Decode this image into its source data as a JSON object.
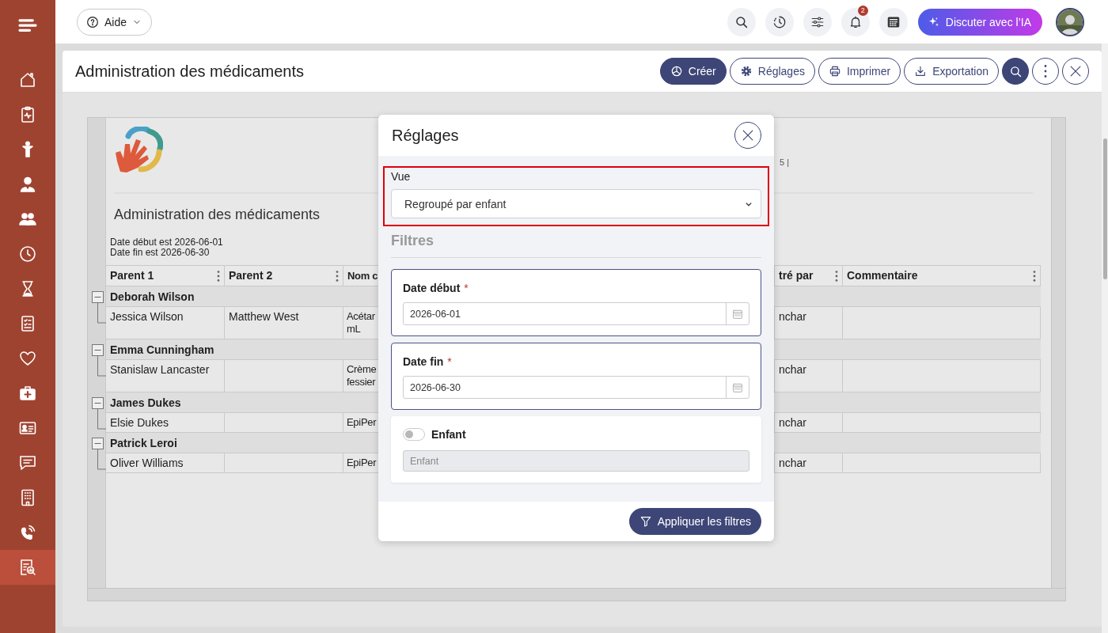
{
  "sidebar": {
    "items": [
      {
        "kind": "home",
        "selected": false
      },
      {
        "kind": "clipboard",
        "selected": false
      },
      {
        "kind": "child",
        "selected": false
      },
      {
        "kind": "user",
        "selected": false
      },
      {
        "kind": "users",
        "selected": false
      },
      {
        "kind": "clock",
        "selected": false
      },
      {
        "kind": "hourglass",
        "selected": false
      },
      {
        "kind": "checklist",
        "selected": false
      },
      {
        "kind": "heart",
        "selected": false
      },
      {
        "kind": "firstaid",
        "selected": false
      },
      {
        "kind": "idcard",
        "selected": false
      },
      {
        "kind": "chat",
        "selected": false
      },
      {
        "kind": "building",
        "selected": false
      },
      {
        "kind": "phone",
        "selected": false
      },
      {
        "kind": "report",
        "selected": true
      }
    ]
  },
  "topbar": {
    "help": "Aide",
    "icons": [
      {
        "kind": "search"
      },
      {
        "kind": "history"
      },
      {
        "kind": "sliders"
      },
      {
        "kind": "bell",
        "badge": "2"
      },
      {
        "kind": "calculator"
      }
    ],
    "ai_button": "Discuter avec l’IA"
  },
  "page": {
    "title": "Administration des médicaments",
    "actions": [
      {
        "kind": "create",
        "label": "Créer",
        "primary": true
      },
      {
        "kind": "settings",
        "label": "Réglages",
        "primary": false
      },
      {
        "kind": "print",
        "label": "Imprimer",
        "primary": false
      },
      {
        "kind": "export",
        "label": "Exportation",
        "primary": false
      },
      {
        "kind": "search",
        "primary": true
      },
      {
        "kind": "more",
        "primary": false
      },
      {
        "kind": "close",
        "primary": false
      }
    ]
  },
  "report": {
    "header_fragment": "5 |",
    "title": "Administration des médicaments",
    "criteria": [
      "Date début est 2026-06-01",
      "Date fin est 2026-06-30"
    ],
    "columns": [
      {
        "label": "Parent 1",
        "menu": true
      },
      {
        "label": "Parent 2",
        "menu": true
      },
      {
        "label": "Nom c",
        "menu": false
      },
      {
        "label": "tré par",
        "menu": true
      },
      {
        "label": "Commentaire",
        "menu": true
      }
    ],
    "groups": [
      {
        "name": "Deborah Wilson",
        "expanded": true,
        "rows": [
          {
            "parent_1": "Jessica Wilson",
            "parent_2": "Matthew West",
            "column_3": "Acétar mL",
            "column_4": "nchar"
          }
        ]
      },
      {
        "name": "Emma Cunningham",
        "expanded": true,
        "rows": [
          {
            "parent_1": "Stanislaw Lancaster",
            "column_3": "Crème fessier",
            "column_4": "nchar"
          }
        ]
      },
      {
        "name": "James Dukes",
        "expanded": true,
        "rows": [
          {
            "parent_1": "Elsie Dukes",
            "column_3": "EpiPer",
            "column_4": "nchar"
          }
        ]
      },
      {
        "name": "Patrick Leroi",
        "expanded": true,
        "rows": [
          {
            "parent_1": "Oliver Williams",
            "column_3": "EpiPer",
            "column_4": "nchar"
          }
        ]
      }
    ]
  },
  "modal": {
    "title": "Réglages",
    "view": {
      "label": "Vue",
      "value": "Regroupé par enfant",
      "highlighted": true
    },
    "filters_heading": "Filtres",
    "filters": [
      {
        "kind": "date",
        "label": "Date début",
        "required_mark": "*",
        "value": "2026-06-01"
      },
      {
        "kind": "date",
        "label": "Date fin",
        "required_mark": "*",
        "value": "2026-06-30"
      },
      {
        "kind": "toggle",
        "label": "Enfant",
        "on": false,
        "placeholder": "Enfant"
      }
    ],
    "apply_button": "Appliquer les filtres"
  }
}
